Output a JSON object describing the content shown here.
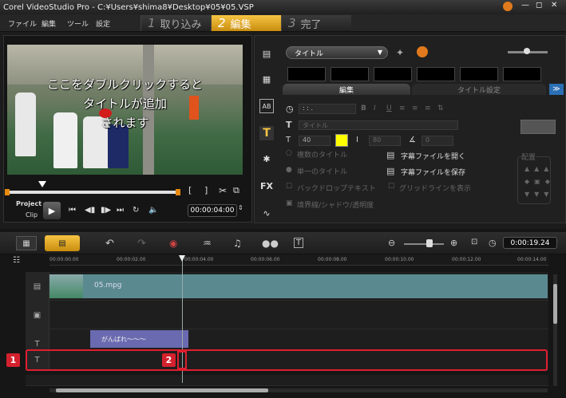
{
  "window": {
    "title": "Corel VideoStudio Pro - C:¥Users¥shima8¥Desktop¥05¥05.VSP"
  },
  "menu": [
    "ファイル",
    "編集",
    "ツール",
    "設定"
  ],
  "steps": [
    {
      "num": "1",
      "label": "取り込み"
    },
    {
      "num": "2",
      "label": "編集"
    },
    {
      "num": "3",
      "label": "完了"
    }
  ],
  "preview": {
    "overlay_lines": [
      "ここをダブルクリックすると",
      "タイトルが追加",
      "されます"
    ],
    "project_label": "Project",
    "clip_label": "Clip",
    "timecode": "00:00:04:00",
    "bracket_in": "[",
    "bracket_out": "]"
  },
  "title_panel": {
    "dropdown": "タイトル",
    "tab_edit": "編集",
    "tab_title_settings": "タイトル設定",
    "timecode": ": : .",
    "font_size": "40",
    "line_spacing": "80",
    "angle": "0",
    "opt_multi": "複数のタイトル",
    "opt_single": "単一のタイトル",
    "opt_backdrop": "バックドロップテキスト",
    "opt_grid": "グリッドラインを表示",
    "open_subtitle": "字幕ファイルを開く",
    "save_subtitle": "字幕ファイルを保存",
    "border": "境界線/シャドウ/透明度",
    "align_label": "配置",
    "text_color": "#ffff00",
    "font_dropdown": "タイトル"
  },
  "timeline": {
    "timecode": "0:00:19.24",
    "ruler": [
      "00:00:00.00",
      "00:00:02.00",
      "00:00:04.00",
      "00:00:06.00",
      "00:00:08.00",
      "00:00:10.00",
      "00:00:12.00",
      "00:00:14.00"
    ],
    "video_clip": "05.mpg",
    "title_clip": "がんばれ～～～",
    "marker1": "1",
    "marker2": "2"
  }
}
